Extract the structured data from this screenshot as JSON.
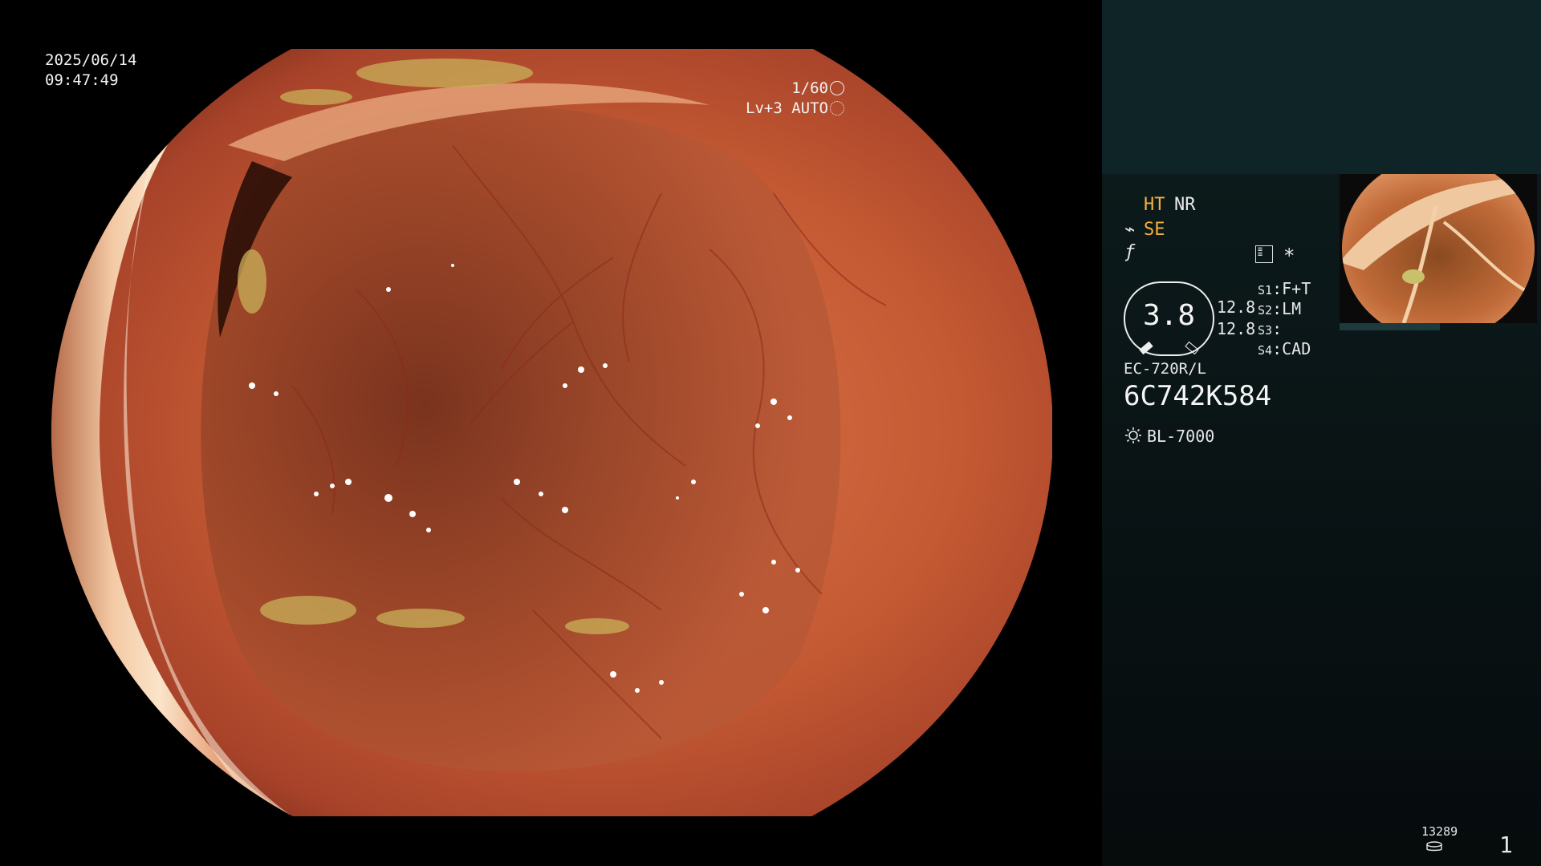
{
  "osd": {
    "date": "2025/06/14",
    "time": "09:47:49",
    "shutter": "1/60",
    "level_mode": "Lv+3 AUTO"
  },
  "panel": {
    "ht": "HT",
    "nr": "NR",
    "se": "SE",
    "zoom": "3.8",
    "value_1": "12.8",
    "value_2": "12.8",
    "slots": [
      {
        "key": "S1",
        "value": "F+T"
      },
      {
        "key": "S2",
        "value": "LM"
      },
      {
        "key": "S3",
        "value": ""
      },
      {
        "key": "S4",
        "value": "CAD"
      }
    ],
    "scope_model": "EC-720R/L",
    "scope_serial": "6C742K584",
    "light_source": "BL-7000",
    "image_counter": "13289",
    "page_number": "1"
  },
  "colors": {
    "accent_orange": "#f4b03c",
    "panel_top": "#0e2426",
    "panel_bg": "#0a1414",
    "mucosa": "#c95a33"
  },
  "icons": [
    "shutter-icon",
    "auto-iris-icon",
    "se-scope-icon",
    "f-icon",
    "menu-icon",
    "star-icon",
    "light-bulb-icon",
    "disk-icon"
  ]
}
